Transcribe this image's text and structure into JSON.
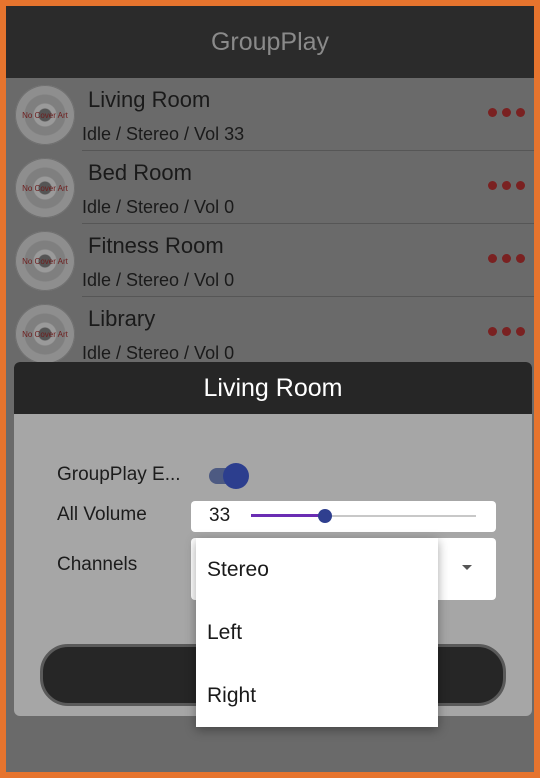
{
  "header": {
    "title": "GroupPlay"
  },
  "rooms": [
    {
      "name": "Living Room",
      "status": "Idle / Stereo / Vol 33",
      "cover_text": "No Cover Art"
    },
    {
      "name": "Bed Room",
      "status": "Idle / Stereo / Vol 0",
      "cover_text": "No Cover Art"
    },
    {
      "name": "Fitness Room",
      "status": "Idle / Stereo / Vol 0",
      "cover_text": "No Cover Art"
    },
    {
      "name": "Library",
      "status": "Idle / Stereo / Vol 0",
      "cover_text": "No Cover Art"
    }
  ],
  "icons": {
    "room_menu": "more-horizontal-icon",
    "cover": "cd-disc-icon",
    "dropdown": "dropdown-arrow-icon"
  },
  "dialog": {
    "title": "Living Room",
    "groupplay_label": "GroupPlay E...",
    "groupplay_enabled": true,
    "volume_label": "All Volume",
    "volume_value": "33",
    "volume_level": 0.33,
    "channels_label": "Channels",
    "channel_options": [
      "Stereo",
      "Left",
      "Right"
    ]
  },
  "colors": {
    "accent": "#2f3f8f",
    "slider_fill": "#6a2db3",
    "menu_dots": "#7a2121",
    "border": "#e6742e"
  }
}
